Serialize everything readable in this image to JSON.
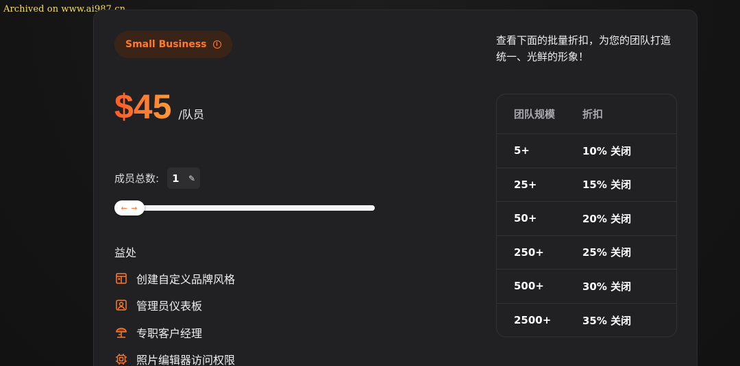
{
  "watermark": "Archived on www.ai987.cn",
  "plan": {
    "name": "Small Business",
    "info_icon": "info-icon"
  },
  "pricing": {
    "price": "$45",
    "per_unit": "/队员"
  },
  "members": {
    "label": "成员总数:",
    "count": "1",
    "edit_icon": "pencil-icon",
    "slider_value": 1,
    "slider_handle_glyph": "← →"
  },
  "benefits": {
    "title": "益处",
    "items": [
      {
        "label": "创建自定义品牌风格",
        "icon": "brand-kit-icon"
      },
      {
        "label": "管理员仪表板",
        "icon": "admin-user-icon"
      },
      {
        "label": "专职客户经理",
        "icon": "beach-umbrella-icon"
      },
      {
        "label": "照片编辑器访问权限",
        "icon": "photo-editor-icon"
      }
    ]
  },
  "promo_text": "查看下面的批量折扣，为您的团队打造统一、光鲜的形象！",
  "discount_table": {
    "headers": [
      "团队规模",
      "折扣"
    ],
    "rows": [
      {
        "size": "5+",
        "discount": "10% 关闭"
      },
      {
        "size": "25+",
        "discount": "15% 关闭"
      },
      {
        "size": "50+",
        "discount": "20% 关闭"
      },
      {
        "size": "250+",
        "discount": "25% 关闭"
      },
      {
        "size": "500+",
        "discount": "30% 关闭"
      },
      {
        "size": "2500+",
        "discount": "35% 关闭"
      }
    ]
  },
  "colors": {
    "accent": "#ff7a2e",
    "card_bg": "#212123",
    "badge_bg": "#3a2418"
  }
}
